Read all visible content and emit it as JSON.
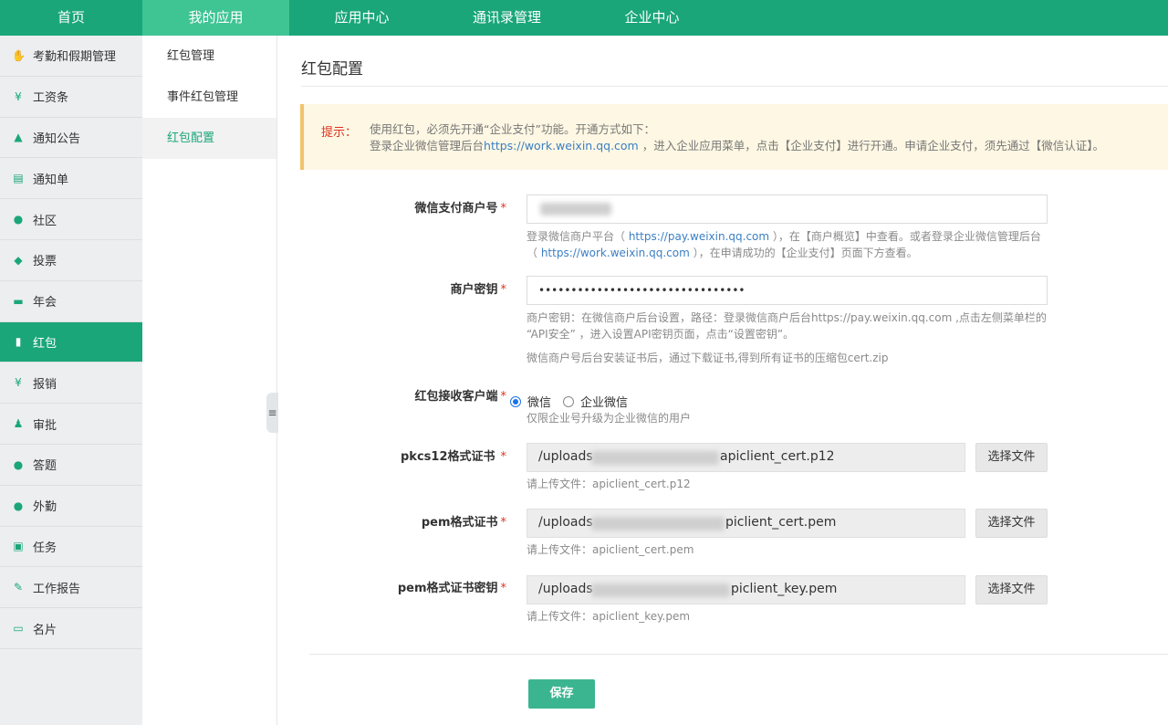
{
  "topnav": [
    "首页",
    "我的应用",
    "应用中心",
    "通讯录管理",
    "企业中心"
  ],
  "sidebar": [
    {
      "label": "考勤和假期管理",
      "icon": "hand-icon"
    },
    {
      "label": "工资条",
      "icon": "money-icon"
    },
    {
      "label": "通知公告",
      "icon": "bell-icon"
    },
    {
      "label": "通知单",
      "icon": "document-icon"
    },
    {
      "label": "社区",
      "icon": "chat-icon"
    },
    {
      "label": "投票",
      "icon": "vote-icon"
    },
    {
      "label": "年会",
      "icon": "banner-icon"
    },
    {
      "label": "红包",
      "icon": "red-packet-icon",
      "active": true
    },
    {
      "label": "报销",
      "icon": "yen-icon"
    },
    {
      "label": "审批",
      "icon": "stamp-icon"
    },
    {
      "label": "答题",
      "icon": "quiz-icon"
    },
    {
      "label": "外勤",
      "icon": "location-icon"
    },
    {
      "label": "任务",
      "icon": "clipboard-icon"
    },
    {
      "label": "工作报告",
      "icon": "edit-icon"
    },
    {
      "label": "名片",
      "icon": "card-icon"
    }
  ],
  "subnav": [
    "红包管理",
    "事件红包管理",
    "红包配置"
  ],
  "page": {
    "title": "红包配置"
  },
  "tip": {
    "label": "提示：",
    "line1": "使用红包，必须先开通“企业支付”功能。开通方式如下：",
    "line2_prefix": "登录企业微信管理后台",
    "line2_link": "https://work.weixin.qq.com",
    "line2_suffix": " ，进入企业应用菜单，点击【企业支付】进行开通。申请企业支付，须先通过【微信认证】。"
  },
  "form": {
    "merchant_id": {
      "label": "微信支付商户号",
      "required": "*",
      "help1_a": "登录微信商户平台（ ",
      "help1_link": "https://pay.weixin.qq.com",
      "help1_b": " ），在【商户概览】中查看。或者登录企业微信管理后台",
      "help2_a": "（ ",
      "help2_link": "https://work.weixin.qq.com",
      "help2_b": " ），在申请成功的【企业支付】页面下方查看。"
    },
    "merchant_key": {
      "label": "商户密钥",
      "required": "*",
      "value": "••••••••••••••••••••••••••••••••",
      "help1": "商户密钥：在微信商户后台设置，路径：登录微信商户后台https://pay.weixin.qq.com ,点击左侧菜单栏的",
      "help2": "“API安全” ，进入设置API密钥页面，点击“设置密钥”。",
      "help3": "微信商户号后台安装证书后，通过下载证书,得到所有证书的压缩包cert.zip"
    },
    "client": {
      "label": "红包接收客户端",
      "required": "*",
      "options": [
        "微信",
        "企业微信"
      ],
      "selected": "微信",
      "help": "仅限企业号升级为企业微信的用户"
    },
    "p12": {
      "label": "pkcs12格式证书",
      "required": "*",
      "value_prefix": "/uploads",
      "value_suffix": "apiclient_cert.p12",
      "button": "选择文件",
      "help": "请上传文件：apiclient_cert.p12"
    },
    "pem": {
      "label": "pem格式证书",
      "required": "*",
      "value_prefix": "/uploads",
      "value_suffix": "piclient_cert.pem",
      "button": "选择文件",
      "help": "请上传文件：apiclient_cert.pem"
    },
    "pem_key": {
      "label": "pem格式证书密钥",
      "required": "*",
      "value_prefix": "/uploads",
      "value_suffix": "piclient_key.pem",
      "button": "选择文件",
      "help": "请上传文件：apiclient_key.pem"
    }
  },
  "save_label": "保存",
  "collapse_icon": "≡"
}
